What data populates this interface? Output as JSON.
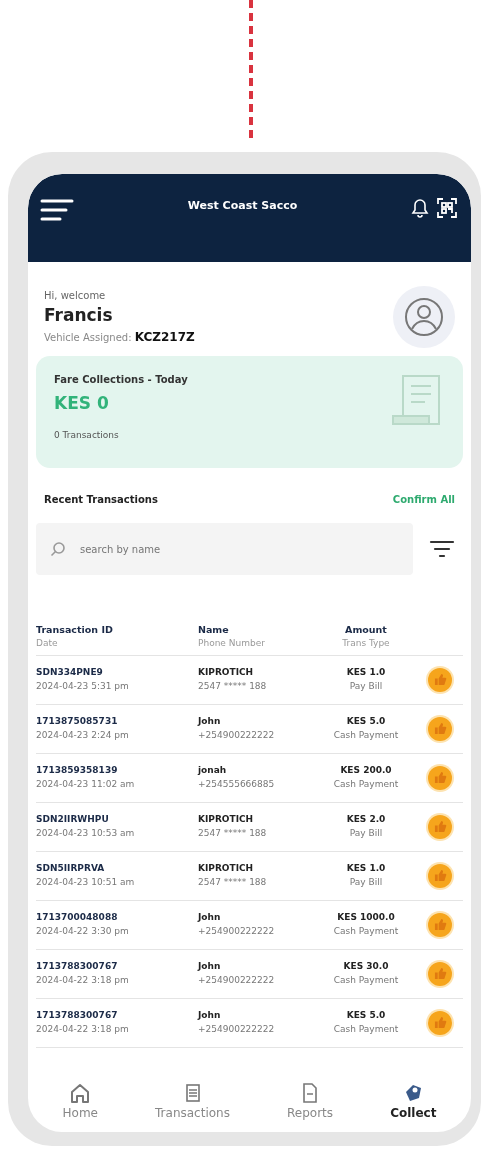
{
  "app_bar": {
    "title": "West Coast Sacco"
  },
  "greeting": {
    "salutation": "Hi, welcome",
    "name": "Francis",
    "vehicle_label": "Vehicle Assigned:",
    "vehicle": "KCZ217Z"
  },
  "summary_card": {
    "title": "Fare Collections - Today",
    "amount": "KES 0",
    "count": "0 Transactions"
  },
  "recent": {
    "title": "Recent Transactions",
    "action": "Confirm All"
  },
  "search": {
    "placeholder": "search by name"
  },
  "table": {
    "columns": [
      {
        "top": "Transaction ID",
        "bottom": "Date"
      },
      {
        "top": "Name",
        "bottom": "Phone Number"
      },
      {
        "top": "Amount",
        "bottom": "Trans Type"
      }
    ],
    "rows": [
      {
        "id": "SDN334PNE9",
        "date": "2024-04-23 5:31 pm",
        "name": "KIPROTICH",
        "phone": "2547 ***** 188",
        "amount": "KES 1.0",
        "type": "Pay Bill"
      },
      {
        "id": "1713875085731",
        "date": "2024-04-23 2:24 pm",
        "name": "John",
        "phone": "+254900222222",
        "amount": "KES 5.0",
        "type": "Cash Payment"
      },
      {
        "id": "1713859358139",
        "date": "2024-04-23 11:02 am",
        "name": "jonah",
        "phone": "+254555666885",
        "amount": "KES 200.0",
        "type": "Cash Payment"
      },
      {
        "id": "SDN2IIRWHPU",
        "date": "2024-04-23 10:53 am",
        "name": "KIPROTICH",
        "phone": "2547 ***** 188",
        "amount": "KES 2.0",
        "type": "Pay Bill"
      },
      {
        "id": "SDN5IIRPRVA",
        "date": "2024-04-23 10:51 am",
        "name": "KIPROTICH",
        "phone": "2547 ***** 188",
        "amount": "KES 1.0",
        "type": "Pay Bill"
      },
      {
        "id": "1713700048088",
        "date": "2024-04-22 3:30 pm",
        "name": "John",
        "phone": "+254900222222",
        "amount": "KES 1000.0",
        "type": "Cash Payment"
      },
      {
        "id": "1713788300767",
        "date": "2024-04-22 3:18 pm",
        "name": "John",
        "phone": "+254900222222",
        "amount": "KES 30.0",
        "type": "Cash Payment"
      },
      {
        "id": "1713788300767",
        "date": "2024-04-22 3:18 pm",
        "name": "John",
        "phone": "+254900222222",
        "amount": "KES 5.0",
        "type": "Cash Payment"
      }
    ]
  },
  "bottom_nav": [
    {
      "label": "Home",
      "kind": "home",
      "selected": false
    },
    {
      "label": "Transactions",
      "kind": "list",
      "selected": false
    },
    {
      "label": "Reports",
      "kind": "report",
      "selected": false
    },
    {
      "label": "Collect",
      "kind": "collect",
      "selected": true
    }
  ]
}
